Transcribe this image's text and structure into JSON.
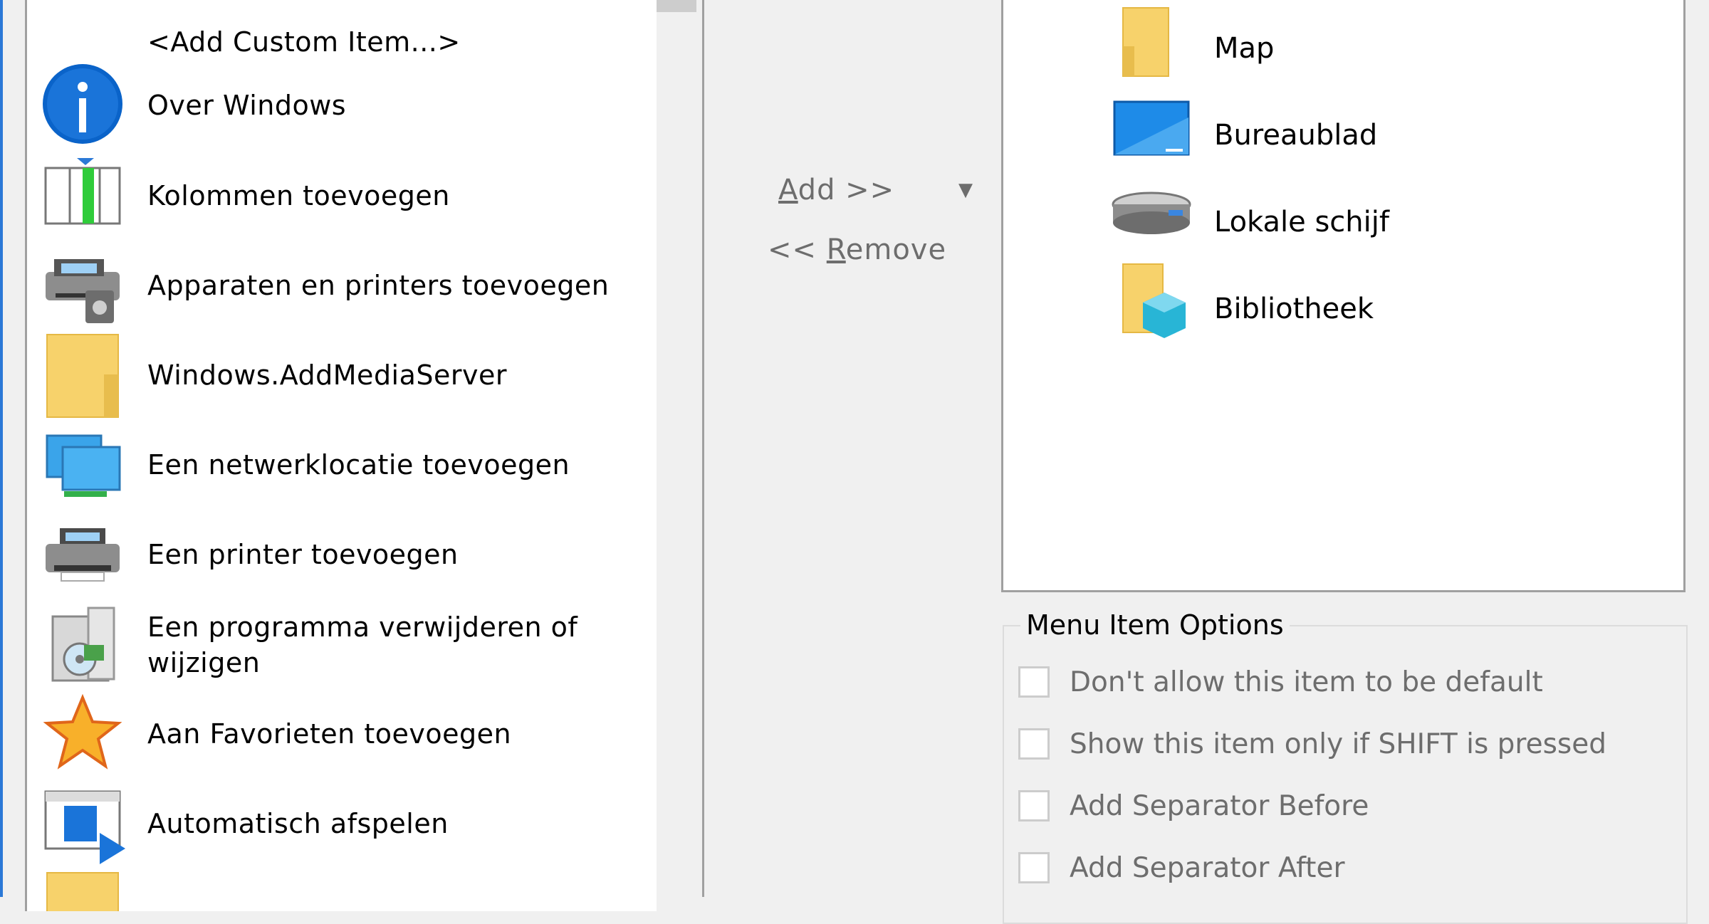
{
  "left_list": {
    "items": [
      {
        "label": "<Add Custom Item...>",
        "icon": "none"
      },
      {
        "label": "Over Windows",
        "icon": "info-icon"
      },
      {
        "label": "Kolommen toevoegen",
        "icon": "columns-icon"
      },
      {
        "label": "Apparaten en printers toevoegen",
        "icon": "devices-printers-icon"
      },
      {
        "label": "Windows.AddMediaServer",
        "icon": "folder-icon"
      },
      {
        "label": "Een netwerklocatie toevoegen",
        "icon": "network-location-icon"
      },
      {
        "label": "Een printer toevoegen",
        "icon": "printer-icon"
      },
      {
        "label": "Een programma verwijderen of",
        "label_line2": "wijzigen",
        "icon": "uninstall-program-icon"
      },
      {
        "label": "Aan Favorieten toevoegen",
        "icon": "star-icon"
      },
      {
        "label": "Automatisch afspelen",
        "icon": "autoplay-icon"
      },
      {
        "label": "",
        "icon": "folder-icon"
      }
    ]
  },
  "buttons": {
    "add_label": "Add >>",
    "add_prefix": "",
    "add_mnemonic": "A",
    "add_rest": "dd >>",
    "remove_prefix": "<< ",
    "remove_mnemonic": "R",
    "remove_rest": "emove"
  },
  "right_list": {
    "items": [
      {
        "label": "Map",
        "icon": "folder-icon"
      },
      {
        "label": "Bureaublad",
        "icon": "desktop-icon"
      },
      {
        "label": "Lokale schijf",
        "icon": "hard-drive-icon"
      },
      {
        "label": "Bibliotheek",
        "icon": "library-icon"
      }
    ]
  },
  "options": {
    "title": "Menu Item Options",
    "checkboxes": [
      {
        "label": "Don't allow this item to be default",
        "checked": false
      },
      {
        "label": "Show this item only if SHIFT is pressed",
        "checked": false
      },
      {
        "label": "Add Separator Before",
        "checked": false
      },
      {
        "label": "Add Separator After",
        "checked": false
      }
    ]
  },
  "colors": {
    "accent": "#2b79d7",
    "disabled_text": "#6d6d6d",
    "folder": "#f7d26b"
  }
}
